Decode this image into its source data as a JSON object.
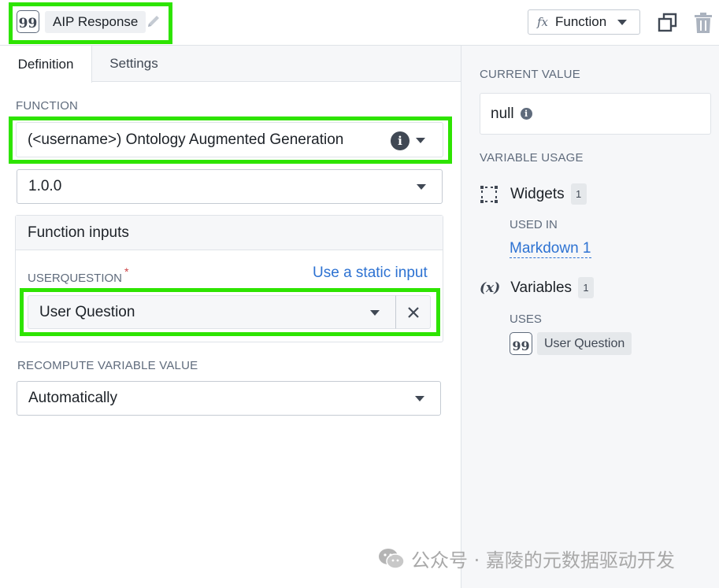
{
  "header": {
    "title": "AIP Response",
    "function_button_label": "Function",
    "fx_symbol": "fx"
  },
  "tabs": [
    {
      "label": "Definition",
      "active": true
    },
    {
      "label": "Settings",
      "active": false
    }
  ],
  "definition": {
    "function_label": "FUNCTION",
    "function_value": "(<username>) Ontology Augmented Generation",
    "version_value": "1.0.0",
    "function_inputs_title": "Function inputs",
    "userquestion_label": "USERQUESTION",
    "required_mark": "*",
    "static_input_link": "Use a static input",
    "userquestion_value": "User Question",
    "recompute_label": "RECOMPUTE VARIABLE VALUE",
    "recompute_value": "Automatically"
  },
  "sidebar": {
    "current_value_label": "CURRENT VALUE",
    "current_value": "null",
    "variable_usage_label": "VARIABLE USAGE",
    "widgets_label": "Widgets",
    "widgets_count": "1",
    "used_in_label": "USED IN",
    "used_in_item": "Markdown 1",
    "variables_label": "Variables",
    "variables_count": "1",
    "x_symbol": "(x)",
    "uses_label": "USES",
    "uses_item": "User Question"
  },
  "watermark": "公众号 · 嘉陵的元数据驱动开发",
  "colors": {
    "highlight": "#2ee400",
    "link": "#2d72d2",
    "required": "#cd4246"
  },
  "icons": [
    "quote-icon",
    "pencil-icon",
    "fx-icon",
    "copy-icon",
    "trash-icon",
    "info-icon",
    "caret-down-icon",
    "close-icon",
    "widgets-icon",
    "variable-icon",
    "wechat-icon"
  ]
}
